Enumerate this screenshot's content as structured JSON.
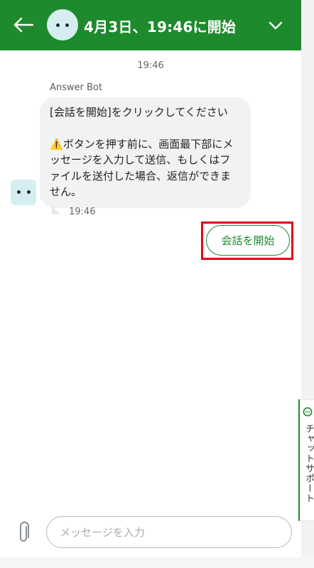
{
  "colors": {
    "brand_green": "#1e8a2e",
    "highlight_red": "#e4001b",
    "bubble_bg": "#f1f2f4",
    "avatar_bg": "#d6eef2"
  },
  "header": {
    "title": "4月3日、19:46に開始",
    "back_icon": "arrow-left-icon",
    "collapse_icon": "chevron-down-icon"
  },
  "conversation": {
    "top_timestamp": "19:46",
    "sender_name": "Answer Bot",
    "message": {
      "line1": "[会話を開始]をクリックしてください",
      "warning_emoji": "⚠️",
      "body": "ボタンを押す前に、画面最下部にメッセージを入力して送信、もしくはファイルを送付した場合、返信ができません。",
      "time": "19:46"
    },
    "start_button_label": "会話を開始"
  },
  "side_tab": {
    "label": "チャットサポート",
    "icon": "chat-bubble-icon"
  },
  "composer": {
    "placeholder": "メッセージを入力",
    "value": "",
    "attach_icon": "paperclip-icon"
  }
}
